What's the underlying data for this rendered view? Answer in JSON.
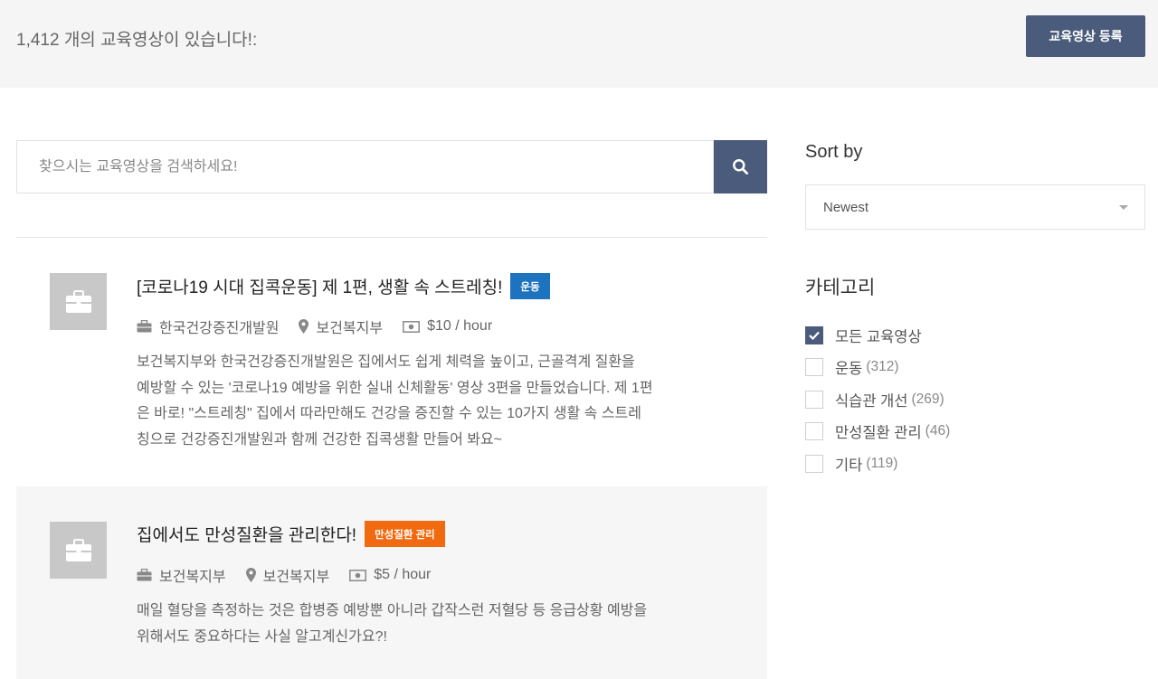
{
  "header": {
    "count_text": "1,412 개의 교육영상이 있습니다!:",
    "register_label": "교육영상 등록"
  },
  "search": {
    "placeholder": "찾으시는 교육영상을 검색하세요!",
    "button_icon": "search-icon"
  },
  "listings": [
    {
      "title": "[코로나19 시대 집콕운동] 제 1편, 생활 속 스트레칭!",
      "badge": "운동",
      "badge_color": "#1e73be",
      "company": "한국건강증진개발원",
      "location": "보건복지부",
      "rate": "$10 / hour",
      "desc_lines": [
        "보건복지부와 한국건강증진개발원은 집에서도 쉽게 체력을 높이고, 근골격계 질환을",
        "예방할 수 있는 '코로나19 예방을 위한 실내 신체활동' 영상 3편을 만들었습니다. 제 1편",
        "은 바로! \"스트레칭\" 집에서 따라만해도 건강을 증진할 수 있는 10가지 생활 속 스트레",
        "칭으로 건강증진개발원과 함께 건강한 집콕생활 만들어 봐요~"
      ]
    },
    {
      "title": "집에서도 만성질환을 관리한다!",
      "badge": "만성질환 관리",
      "badge_color": "#f26a0f",
      "company": "보건복지부",
      "location": "보건복지부",
      "rate": "$5 / hour",
      "desc_lines": [
        "매일 혈당을 측정하는 것은 합병증 예방뿐 아니라 갑작스런 저혈당 등 응급상황 예방을",
        "위해서도 중요하다는 사실 알고계신가요?!"
      ]
    }
  ],
  "sidebar": {
    "sort_title": "Sort by",
    "sort_value": "Newest",
    "category_title": "카테고리",
    "categories": [
      {
        "label": "모든 교육영상",
        "count": "",
        "checked": true
      },
      {
        "label": "운동",
        "count": "(312)",
        "checked": false
      },
      {
        "label": "식습관 개선",
        "count": "(269)",
        "checked": false
      },
      {
        "label": "만성질환 관리",
        "count": "(46)",
        "checked": false
      },
      {
        "label": "기타",
        "count": "(119)",
        "checked": false
      }
    ]
  },
  "colors": {
    "accent": "#4a5b7b",
    "badge_blue": "#1e73be",
    "badge_orange": "#f26a0f"
  }
}
